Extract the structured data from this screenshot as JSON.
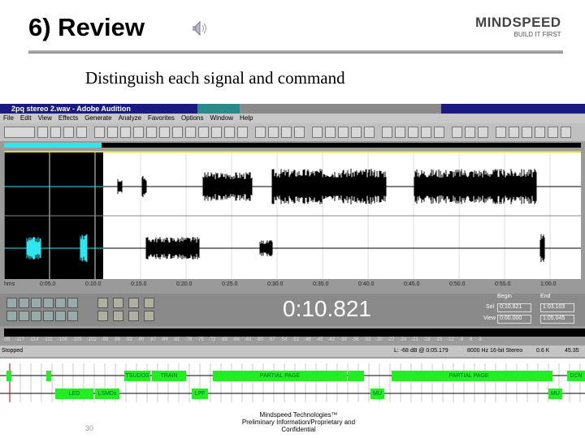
{
  "slide": {
    "title": "6) Review",
    "subtitle": "Distinguish each signal and command",
    "page_number": "30",
    "logo": {
      "brand": "MINDSPEED",
      "tagline": "BUILD IT FIRST"
    },
    "footer": [
      "Mindspeed Technologies™",
      "Preliminary Information/Proprietary and",
      "Confidential"
    ]
  },
  "app": {
    "title": "2pq stereo 2.wav - Adobe Audition",
    "menu": [
      "File",
      "Edit",
      "View",
      "Effects",
      "Generate",
      "Analyze",
      "Favorites",
      "Options",
      "Window",
      "Help"
    ],
    "ruler": [
      "hms",
      "0:05.0",
      "0:10.0",
      "0:15.0",
      "0:20.0",
      "0:25.0",
      "0:30.0",
      "0:35.0",
      "0:40.0",
      "0:45.0",
      "0:50.0",
      "0:55.0",
      "1:00.0"
    ],
    "time": "0:10.821",
    "sel_view": {
      "begin_label": "Begin",
      "end_label": "End",
      "sel_label": "Sel",
      "view_label": "View",
      "sel_begin": "0:10.821",
      "sel_end": "1:03.103",
      "view_begin": "0:00.000",
      "view_end": "1:05.045"
    },
    "db_scale": [
      "dB",
      "-117",
      "-114",
      "-111",
      "-108",
      "-105",
      "-102",
      "-99",
      "-96",
      "-93",
      "-90",
      "-87",
      "-84",
      "-81",
      "-78",
      "-75",
      "-72",
      "-69",
      "-66",
      "-63",
      "-60",
      "-57",
      "-54",
      "-51",
      "-48",
      "-45",
      "-42",
      "-39",
      "-36",
      "-33",
      "-30",
      "-27",
      "-24",
      "-21",
      "-18",
      "-15",
      "-12",
      "-9",
      "-6",
      "-3"
    ],
    "status": {
      "state": "Stopped",
      "level": "L: -68 dB @ 0:05.179",
      "format": "8000 Hz 16-bit Stereo",
      "size": "0.6 K",
      "free": "45.35"
    }
  },
  "diagram": {
    "top": [
      "TSUDOS",
      "TRAIN",
      "PARTIAL PAGE",
      "PARTIAL PAGE",
      "DCN"
    ],
    "bottom": [
      "LED",
      "LSMDs",
      "LPF",
      "MU",
      "MU"
    ],
    "color": "#22ee22"
  }
}
